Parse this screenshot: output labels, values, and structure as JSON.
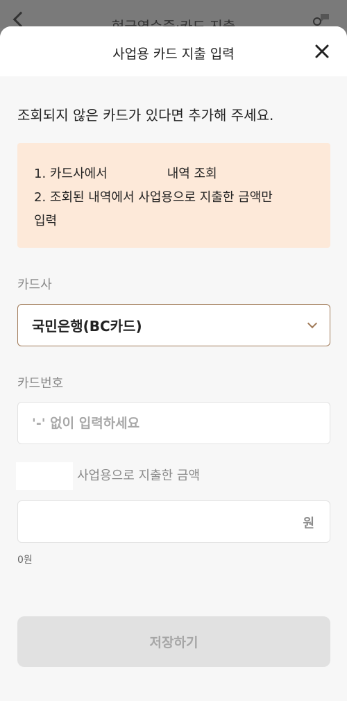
{
  "background": {
    "title": "현금영수증·카드 지출"
  },
  "sheet": {
    "title": "사업용 카드 지출 입력",
    "intro": "조회되지 않은 카드가 있다면 추가해 주세요.",
    "notice": {
      "line1_prefix": "1. 카드사에서",
      "line1_suffix": "내역 조회",
      "line2": "2. 조회된 내역에서 사업용으로 지출한 금액만",
      "line3": "입력"
    },
    "card_company": {
      "label": "카드사",
      "value": "국민은행(BC카드)"
    },
    "card_number": {
      "label": "카드번호",
      "placeholder": "'-' 없이 입력하세요",
      "value": ""
    },
    "amount": {
      "label": "사업용으로 지출한 금액",
      "suffix": "원",
      "value": "",
      "sum_text": "0원"
    },
    "save_label": "저장하기"
  },
  "colors": {
    "accent": "#a07a58",
    "notice_bg": "#fde9d9",
    "disabled_btn": "#e1e1e1"
  }
}
